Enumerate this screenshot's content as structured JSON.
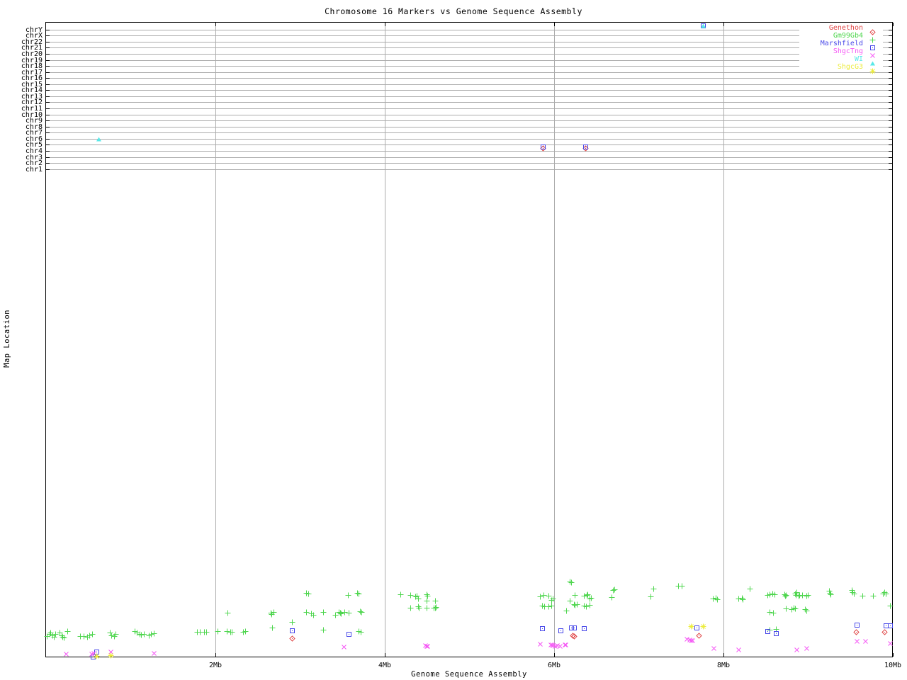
{
  "title": "Chromosome 16 Markers vs Genome Sequence Assembly",
  "colors": {
    "genethon": "#e04848",
    "gm99gb4": "#4fd64f",
    "marshfield": "#4848e8",
    "shgctng": "#f556f5",
    "wi": "#58e8e8",
    "shgcg3": "#ecec3c",
    "grid": "#ababab",
    "border": "#000000"
  },
  "legend": {
    "items": [
      {
        "label": "Genethon",
        "marker": "diamond",
        "color": "#e04848"
      },
      {
        "label": "Gm99Gb4",
        "marker": "plus",
        "color": "#4fd64f"
      },
      {
        "label": "Marshfield",
        "marker": "square",
        "color": "#4848e8"
      },
      {
        "label": "ShgcTng",
        "marker": "x",
        "color": "#f556f5"
      },
      {
        "label": "WI",
        "marker": "triangle",
        "color": "#58e8e8"
      },
      {
        "label": "ShgcG3",
        "marker": "star",
        "color": "#ecec3c"
      }
    ]
  },
  "chart_data": {
    "type": "scatter",
    "title": "Chromosome 16 Markers vs Genome Sequence Assembly",
    "xlabel": "Genome Sequence Assembly",
    "ylabel": "Map Location",
    "x_axis": {
      "min_mb": 0,
      "max_mb": 10,
      "grid": true,
      "ticks": [
        {
          "label": "2Mb",
          "mb": 2
        },
        {
          "label": "4Mb",
          "mb": 4
        },
        {
          "label": "6Mb",
          "mb": 6
        },
        {
          "label": "8Mb",
          "mb": 8
        },
        {
          "label": "10Mb",
          "mb": 10
        }
      ]
    },
    "y_axis": {
      "grid": true,
      "tick_labels": [
        "chrY",
        "chrX",
        "chr22",
        "chr21",
        "chr20",
        "chr19",
        "chr18",
        "chr17",
        "chr16",
        "chr15",
        "chr14",
        "chr13",
        "chr12",
        "chr11",
        "chr10",
        "chr9",
        "chr8",
        "chr7",
        "chr6",
        "chr5",
        "chr4",
        "chr3",
        "chr2",
        "chr1"
      ]
    },
    "legend_position": "top-right",
    "series": [
      {
        "name": "Gm99Gb4",
        "marker": "plus",
        "color": "#4fd64f",
        "points": [
          [
            0.02,
            898
          ],
          [
            0.05,
            895
          ],
          [
            0.06,
            893
          ],
          [
            0.08,
            897
          ],
          [
            0.1,
            899
          ],
          [
            0.12,
            895
          ],
          [
            0.17,
            893
          ],
          [
            0.19,
            897
          ],
          [
            0.2,
            899
          ],
          [
            0.22,
            900
          ],
          [
            0.26,
            891
          ],
          [
            0.41,
            898
          ],
          [
            0.45,
            898
          ],
          [
            0.49,
            899
          ],
          [
            0.52,
            897
          ],
          [
            0.55,
            895
          ],
          [
            0.76,
            893
          ],
          [
            0.78,
            897
          ],
          [
            0.81,
            898
          ],
          [
            0.83,
            895
          ],
          [
            1.05,
            891
          ],
          [
            1.08,
            893
          ],
          [
            1.11,
            895
          ],
          [
            1.13,
            896
          ],
          [
            1.16,
            895
          ],
          [
            1.22,
            897
          ],
          [
            1.25,
            895
          ],
          [
            1.28,
            894
          ],
          [
            1.79,
            892
          ],
          [
            1.82,
            892
          ],
          [
            1.87,
            892
          ],
          [
            1.9,
            892
          ],
          [
            2.03,
            891
          ],
          [
            2.14,
            891
          ],
          [
            2.18,
            892
          ],
          [
            2.2,
            892
          ],
          [
            2.33,
            892
          ],
          [
            2.36,
            891
          ],
          [
            2.15,
            865
          ],
          [
            2.66,
            865
          ],
          [
            2.67,
            867
          ],
          [
            2.69,
            864
          ],
          [
            2.68,
            886
          ],
          [
            2.91,
            878
          ],
          [
            3.08,
            837
          ],
          [
            3.1,
            838
          ],
          [
            3.08,
            864
          ],
          [
            3.14,
            866
          ],
          [
            3.16,
            868
          ],
          [
            3.28,
            864
          ],
          [
            3.28,
            889
          ],
          [
            3.42,
            868
          ],
          [
            3.46,
            864
          ],
          [
            3.48,
            865
          ],
          [
            3.49,
            866
          ],
          [
            3.53,
            864
          ],
          [
            3.58,
            865
          ],
          [
            3.57,
            840
          ],
          [
            3.68,
            837
          ],
          [
            3.7,
            838
          ],
          [
            3.71,
            863
          ],
          [
            3.73,
            864
          ],
          [
            3.7,
            891
          ],
          [
            3.72,
            892
          ],
          [
            4.19,
            839
          ],
          [
            4.31,
            840
          ],
          [
            4.37,
            842
          ],
          [
            4.38,
            841
          ],
          [
            4.4,
            845
          ],
          [
            4.5,
            839
          ],
          [
            4.51,
            841
          ],
          [
            4.5,
            848
          ],
          [
            4.6,
            848
          ],
          [
            4.31,
            858
          ],
          [
            4.4,
            856
          ],
          [
            4.41,
            858
          ],
          [
            4.5,
            858
          ],
          [
            4.58,
            858
          ],
          [
            4.6,
            858
          ],
          [
            4.61,
            857
          ],
          [
            5.84,
            842
          ],
          [
            5.88,
            840
          ],
          [
            5.94,
            841
          ],
          [
            5.97,
            847
          ],
          [
            5.99,
            845
          ],
          [
            5.86,
            855
          ],
          [
            5.89,
            856
          ],
          [
            5.94,
            856
          ],
          [
            5.97,
            855
          ],
          [
            6.15,
            862
          ],
          [
            6.19,
            821
          ],
          [
            6.21,
            822
          ],
          [
            6.25,
            840
          ],
          [
            6.19,
            848
          ],
          [
            6.24,
            853
          ],
          [
            6.25,
            854
          ],
          [
            6.27,
            853
          ],
          [
            6.36,
            841
          ],
          [
            6.39,
            840
          ],
          [
            6.4,
            839
          ],
          [
            6.42,
            845
          ],
          [
            6.44,
            844
          ],
          [
            6.36,
            855
          ],
          [
            6.38,
            856
          ],
          [
            6.42,
            854
          ],
          [
            6.68,
            843
          ],
          [
            6.7,
            833
          ],
          [
            6.72,
            832
          ],
          [
            7.14,
            842
          ],
          [
            7.18,
            831
          ],
          [
            7.47,
            827
          ],
          [
            7.51,
            827
          ],
          [
            7.88,
            845
          ],
          [
            7.91,
            844
          ],
          [
            7.93,
            846
          ],
          [
            8.18,
            845
          ],
          [
            8.22,
            844
          ],
          [
            8.23,
            846
          ],
          [
            8.31,
            831
          ],
          [
            8.52,
            840
          ],
          [
            8.55,
            839
          ],
          [
            8.58,
            838
          ],
          [
            8.61,
            839
          ],
          [
            8.72,
            839
          ],
          [
            8.73,
            841
          ],
          [
            8.74,
            840
          ],
          [
            8.85,
            838
          ],
          [
            8.86,
            840
          ],
          [
            8.87,
            836
          ],
          [
            8.89,
            841
          ],
          [
            8.9,
            840
          ],
          [
            8.93,
            840
          ],
          [
            8.98,
            841
          ],
          [
            9.0,
            840
          ],
          [
            9.25,
            834
          ],
          [
            9.26,
            837
          ],
          [
            9.27,
            839
          ],
          [
            9.52,
            833
          ],
          [
            9.53,
            836
          ],
          [
            9.54,
            838
          ],
          [
            9.64,
            841
          ],
          [
            9.77,
            841
          ],
          [
            9.89,
            838
          ],
          [
            9.9,
            836
          ],
          [
            9.92,
            838
          ],
          [
            9.97,
            855
          ],
          [
            8.55,
            864
          ],
          [
            8.59,
            865
          ],
          [
            8.74,
            859
          ],
          [
            8.81,
            860
          ],
          [
            8.83,
            858
          ],
          [
            8.85,
            859
          ],
          [
            8.97,
            860
          ],
          [
            8.98,
            862
          ],
          [
            8.55,
            889
          ],
          [
            8.62,
            888
          ]
        ]
      },
      {
        "name": "Genethon",
        "marker": "diamond",
        "color": "#e04848",
        "points": [
          [
            5.87,
            209
          ],
          [
            6.37,
            209
          ],
          [
            2.91,
            901
          ],
          [
            6.22,
            897
          ],
          [
            6.24,
            898
          ],
          [
            7.71,
            897
          ],
          [
            9.57,
            892
          ],
          [
            9.9,
            892
          ]
        ]
      },
      {
        "name": "Marshfield",
        "marker": "square",
        "color": "#4848e8",
        "points": [
          [
            7.76,
            36
          ],
          [
            5.87,
            207
          ],
          [
            6.37,
            207
          ],
          [
            0.56,
            927
          ],
          [
            0.6,
            920
          ],
          [
            2.91,
            890
          ],
          [
            3.58,
            895
          ],
          [
            5.86,
            887
          ],
          [
            6.08,
            890
          ],
          [
            6.21,
            886
          ],
          [
            6.24,
            886
          ],
          [
            6.36,
            887
          ],
          [
            7.69,
            886
          ],
          [
            8.52,
            891
          ],
          [
            8.62,
            894
          ],
          [
            9.58,
            882
          ],
          [
            9.92,
            883
          ],
          [
            9.97,
            883
          ]
        ]
      },
      {
        "name": "ShgcTng",
        "marker": "x",
        "color": "#f556f5",
        "points": [
          [
            0.24,
            923
          ],
          [
            0.54,
            923
          ],
          [
            0.57,
            922
          ],
          [
            0.77,
            920
          ],
          [
            1.28,
            922
          ],
          [
            3.52,
            913
          ],
          [
            4.48,
            911
          ],
          [
            4.5,
            912
          ],
          [
            4.51,
            912
          ],
          [
            5.84,
            909
          ],
          [
            5.96,
            910
          ],
          [
            5.98,
            910
          ],
          [
            5.99,
            911
          ],
          [
            6.01,
            912
          ],
          [
            6.04,
            911
          ],
          [
            6.07,
            912
          ],
          [
            6.13,
            910
          ],
          [
            6.14,
            910
          ],
          [
            7.57,
            902
          ],
          [
            7.6,
            903
          ],
          [
            7.62,
            904
          ],
          [
            7.64,
            904
          ],
          [
            7.89,
            915
          ],
          [
            8.18,
            917
          ],
          [
            8.87,
            917
          ],
          [
            8.98,
            915
          ],
          [
            9.58,
            905
          ],
          [
            9.68,
            905
          ],
          [
            9.97,
            908
          ]
        ]
      },
      {
        "name": "WI",
        "marker": "triangle",
        "color": "#58e8e8",
        "points": [
          [
            0.63,
            196
          ],
          [
            7.76,
            36
          ]
        ]
      },
      {
        "name": "ShgcG3",
        "marker": "star",
        "color": "#ecec3c",
        "points": [
          [
            0.6,
            926
          ],
          [
            0.77,
            925
          ],
          [
            7.62,
            884
          ],
          [
            7.76,
            884
          ]
        ]
      }
    ]
  }
}
